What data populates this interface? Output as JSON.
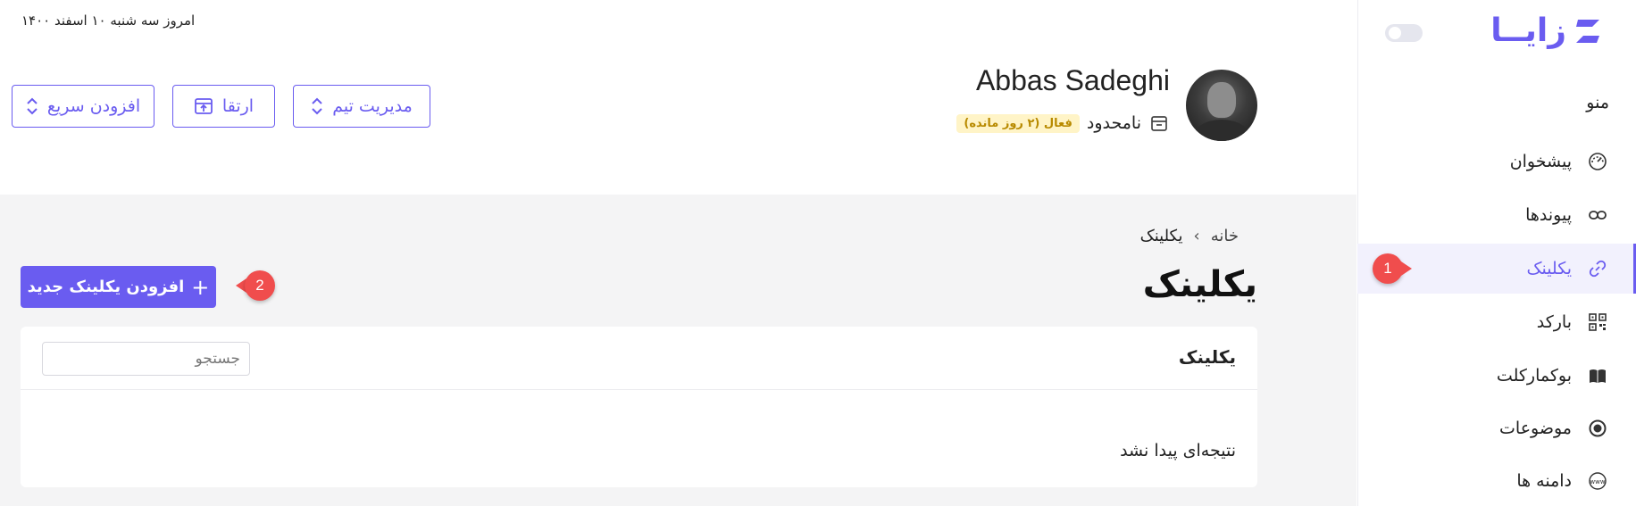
{
  "header": {
    "date_text": "امروز سه شنبه ۱۰ اسفند ۱۴۰۰",
    "user_name": "Abbas Sadeghi",
    "plan_label": "نامحدود",
    "plan_badge": "فعال (۲ روز مانده)",
    "buttons": {
      "team_management": "مدیریت تیم",
      "upgrade": "ارتقا",
      "quick_add": "افزودن سریع"
    }
  },
  "sidebar": {
    "logo_text": "زایــا",
    "menu_title": "منو",
    "items": [
      {
        "label": "پیشخوان",
        "icon": "dashboard-gauge-icon"
      },
      {
        "label": "پیوندها",
        "icon": "link-icon"
      },
      {
        "label": "یکلینک",
        "icon": "link-chain-icon",
        "active": true
      },
      {
        "label": "بارکد",
        "icon": "qr-code-icon"
      },
      {
        "label": "بوکمارکلت",
        "icon": "book-icon"
      },
      {
        "label": "موضوعات",
        "icon": "target-icon"
      },
      {
        "label": "دامنه ها",
        "icon": "www-globe-icon"
      }
    ]
  },
  "breadcrumb": {
    "home": "خانه",
    "separator": "›",
    "current": "یکلینک"
  },
  "page": {
    "title": "یکلینک",
    "add_button_label": "افزودن یکلینک جدید",
    "add_button_icon": "+"
  },
  "card": {
    "title": "یکلینک",
    "search_placeholder": "جستجو",
    "empty_message": "نتیجه‌ای پیدا نشد"
  },
  "annotations": {
    "callout_1": "1",
    "callout_2": "2"
  },
  "colors": {
    "accent": "#6a5cf0",
    "content_bg": "#f4f4f5",
    "callout": "#f04d4d",
    "badge_bg": "#fff4c7",
    "badge_text": "#b88a00"
  }
}
